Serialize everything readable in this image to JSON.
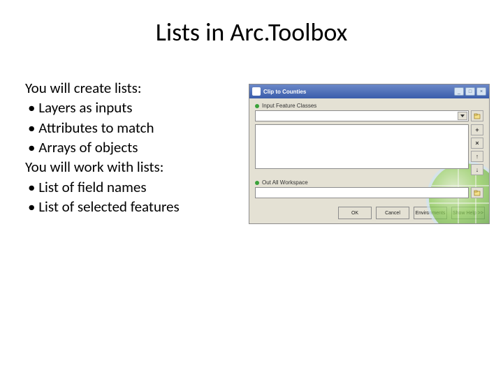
{
  "title": "Lists in Arc.Toolbox",
  "left_text": {
    "intro1": "You will create lists:",
    "bullets1": [
      "Layers as inputs",
      "Attributes to match",
      "Arrays of objects"
    ],
    "intro2": "You will work with lists:",
    "bullets2": [
      "List of field names",
      "List of selected features"
    ]
  },
  "dialog": {
    "title": "Clip to Counties",
    "field1_label": "Input Feature Classes",
    "field2_label": "Out All Workspace",
    "buttons": {
      "ok": "OK",
      "cancel": "Cancel",
      "environments": "Environments",
      "showhelp": "Show Help >>"
    },
    "side_buttons": {
      "add": "+",
      "remove": "×",
      "up": "↑",
      "down": "↓"
    }
  }
}
